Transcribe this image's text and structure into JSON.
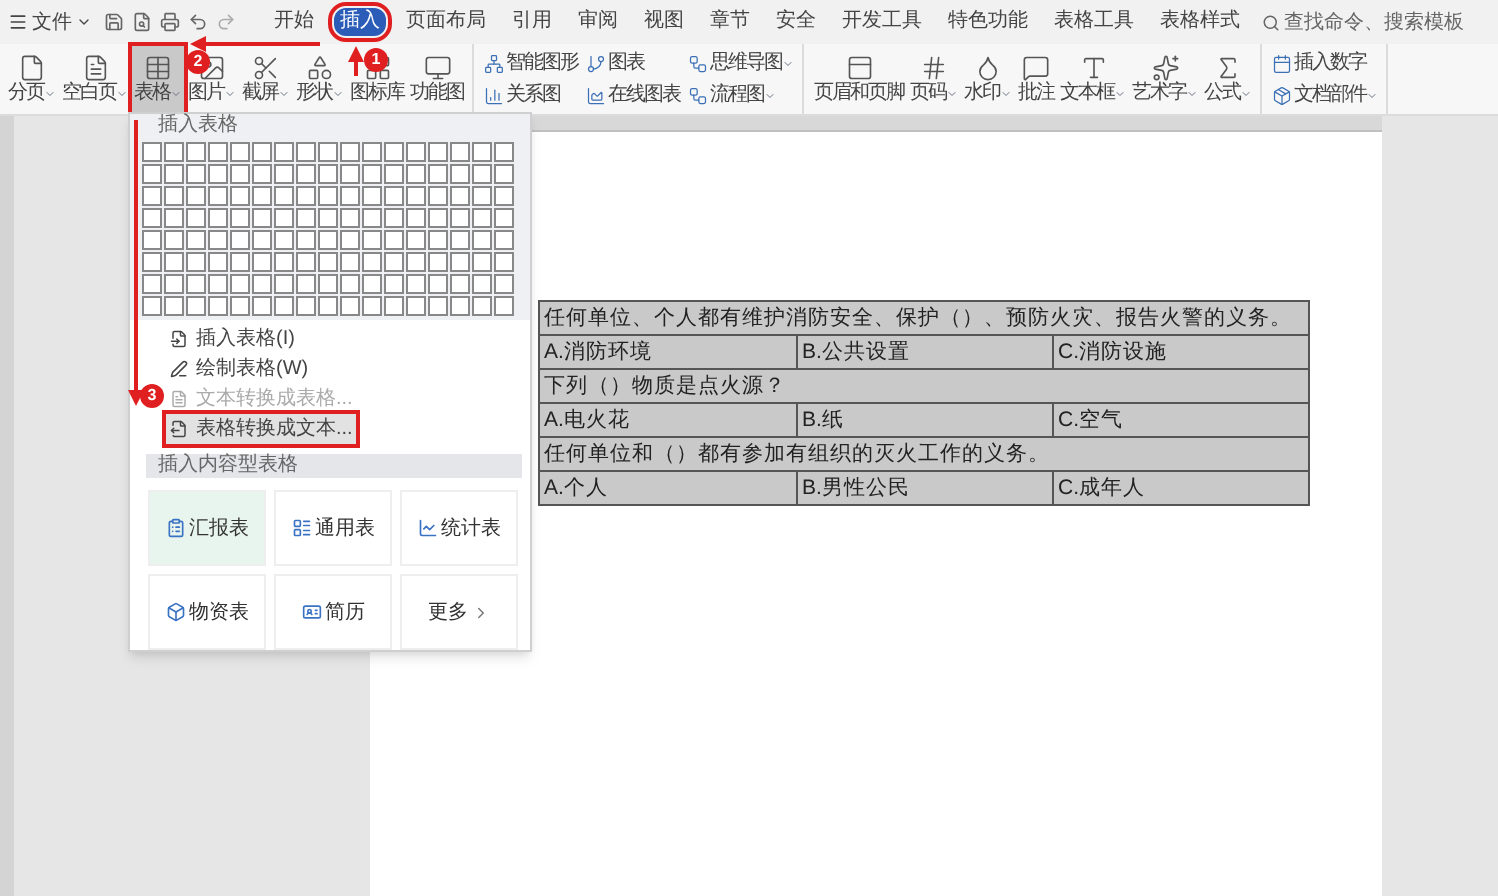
{
  "menu_bar": {
    "file_menu": "文件",
    "tabs": [
      {
        "label": "开始",
        "selected": false
      },
      {
        "label": "插入",
        "selected": true,
        "highlighted": true
      },
      {
        "label": "页面布局",
        "selected": false
      },
      {
        "label": "引用",
        "selected": false
      },
      {
        "label": "审阅",
        "selected": false
      },
      {
        "label": "视图",
        "selected": false
      },
      {
        "label": "章节",
        "selected": false
      },
      {
        "label": "安全",
        "selected": false
      },
      {
        "label": "开发工具",
        "selected": false
      },
      {
        "label": "特色功能",
        "selected": false
      },
      {
        "label": "表格工具",
        "selected": false
      },
      {
        "label": "表格样式",
        "selected": false
      }
    ],
    "search": {
      "placeholder": "查找命令、搜索模板"
    }
  },
  "ribbon": {
    "groups": [
      {
        "kind": "large",
        "items": [
          {
            "label": "分页",
            "has_menu": true,
            "pressed": false
          },
          {
            "label": "空白页",
            "has_menu": true,
            "pressed": false
          },
          {
            "label": "表格",
            "has_menu": true,
            "pressed": true,
            "highlighted": true
          },
          {
            "label": "图片",
            "has_menu": true,
            "pressed": false
          },
          {
            "label": "截屏",
            "has_menu": true,
            "pressed": false
          },
          {
            "label": "形状",
            "has_menu": true,
            "pressed": false
          },
          {
            "label": "图标库",
            "has_menu": false,
            "pressed": false
          },
          {
            "label": "功能图",
            "has_menu": false,
            "pressed": false
          }
        ]
      },
      {
        "kind": "small",
        "items": [
          {
            "label": "智能图形",
            "has_menu": false,
            "pressed": false
          },
          {
            "label": "关系图",
            "has_menu": false,
            "pressed": false
          },
          {
            "label": "图表",
            "has_menu": false,
            "pressed": false
          },
          {
            "label": "在线图表",
            "has_menu": false,
            "pressed": false
          },
          {
            "label": "思维导图",
            "has_menu": true,
            "pressed": false
          },
          {
            "label": "流程图",
            "has_menu": true,
            "pressed": false
          }
        ]
      },
      {
        "kind": "large",
        "items": [
          {
            "label": "页眉和页脚",
            "has_menu": false,
            "pressed": false
          },
          {
            "label": "页码",
            "has_menu": true,
            "pressed": false
          },
          {
            "label": "水印",
            "has_menu": true,
            "pressed": false
          },
          {
            "label": "批注",
            "has_menu": false,
            "pressed": false
          },
          {
            "label": "文本框",
            "has_menu": true,
            "pressed": false
          },
          {
            "label": "艺术字",
            "has_menu": true,
            "pressed": false
          },
          {
            "label": "公式",
            "has_menu": true,
            "pressed": false
          }
        ]
      },
      {
        "kind": "small",
        "items": [
          {
            "label": "插入数字",
            "has_menu": false,
            "pressed": false
          },
          {
            "label": "文档部件",
            "has_menu": true,
            "pressed": false
          }
        ]
      }
    ]
  },
  "table_menu": {
    "header": "插入表格",
    "commands": [
      {
        "label": "插入表格(I)",
        "disabled": false,
        "selected": false
      },
      {
        "label": "绘制表格(W)",
        "disabled": false,
        "selected": false
      },
      {
        "label": "文本转换成表格...",
        "disabled": true,
        "selected": false
      },
      {
        "label": "表格转换成文本...",
        "disabled": false,
        "selected": true,
        "highlighted": true
      }
    ],
    "content_header": "插入内容型表格",
    "templates": [
      {
        "label": "汇报表",
        "kind": "template"
      },
      {
        "label": "通用表",
        "kind": "template"
      },
      {
        "label": "统计表",
        "kind": "template"
      },
      {
        "label": "物资表",
        "kind": "template"
      },
      {
        "label": "简历",
        "kind": "template"
      },
      {
        "label": "更多",
        "kind": "more"
      }
    ]
  },
  "document": {
    "table": {
      "selected": true,
      "rows": [
        {
          "kind": "question",
          "cells": [
            "任何单位、个人都有维护消防安全、保护（）、预防火灾、报告火警的义务。"
          ]
        },
        {
          "kind": "options",
          "cells": [
            "A.消防环境",
            "B.公共设置",
            "C.消防设施"
          ]
        },
        {
          "kind": "question",
          "cells": [
            "下列（）物质是点火源？"
          ]
        },
        {
          "kind": "options",
          "cells": [
            "A.电火花",
            "B.纸",
            "C.空气"
          ]
        },
        {
          "kind": "question",
          "cells": [
            "任何单位和（）都有参加有组织的灭火工作的义务。"
          ]
        },
        {
          "kind": "options",
          "cells": [
            "A.个人",
            "B.男性公民",
            "C.成年人"
          ]
        }
      ]
    }
  },
  "annotations": [
    {
      "label": "1"
    },
    {
      "label": "2"
    },
    {
      "label": "3"
    }
  ]
}
